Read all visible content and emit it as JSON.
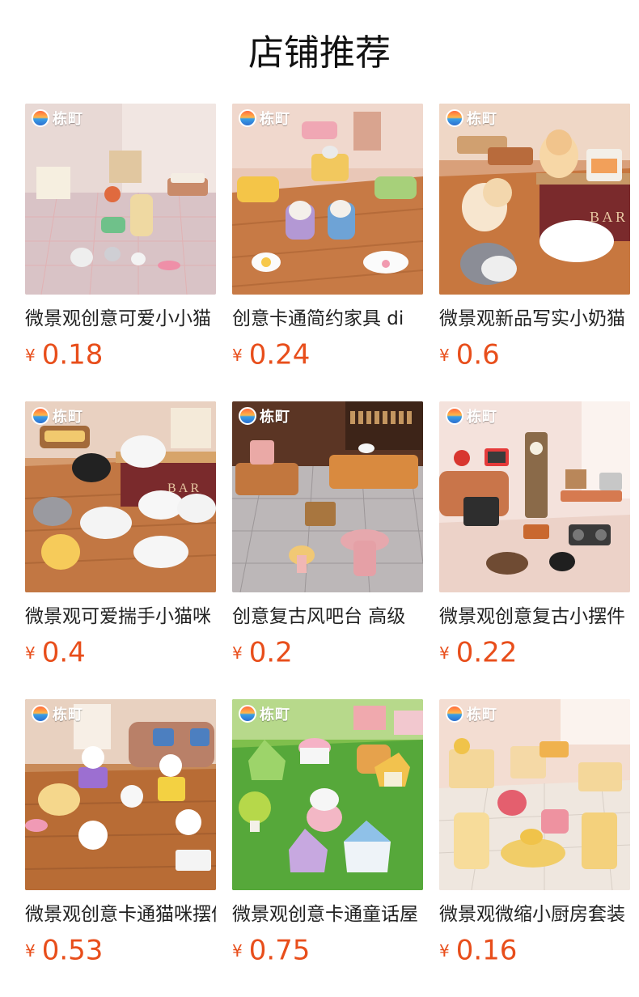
{
  "section_title": "店铺推荐",
  "brand_logo_text": "栋町",
  "currency_symbol": "¥",
  "colors": {
    "price": "#e84e1b",
    "title": "#111111",
    "name": "#222222"
  },
  "products": [
    {
      "name": "微景观创意可爱小小猫",
      "price": "0.18",
      "image": "cat-tree-room"
    },
    {
      "name": "创意卡通简约家具 di",
      "price": "0.24",
      "image": "cartoon-furniture"
    },
    {
      "name": "微景观新品写实小奶猫",
      "price": "0.6",
      "image": "realistic-kittens-bar"
    },
    {
      "name": "微景观可爱揣手小猫咪",
      "price": "0.4",
      "image": "tuck-paw-cats"
    },
    {
      "name": "创意复古风吧台 高级",
      "price": "0.2",
      "image": "retro-bar-counter"
    },
    {
      "name": "微景观创意复古小摆件",
      "price": "0.22",
      "image": "retro-ornaments"
    },
    {
      "name": "微景观创意卡通猫咪摆件",
      "price": "0.53",
      "image": "cartoon-kitty-figures"
    },
    {
      "name": "微景观创意卡通童话屋",
      "price": "0.75",
      "image": "fairy-tale-houses"
    },
    {
      "name": "微景观微缩小厨房套装",
      "price": "0.16",
      "image": "mini-kitchen-set"
    }
  ]
}
